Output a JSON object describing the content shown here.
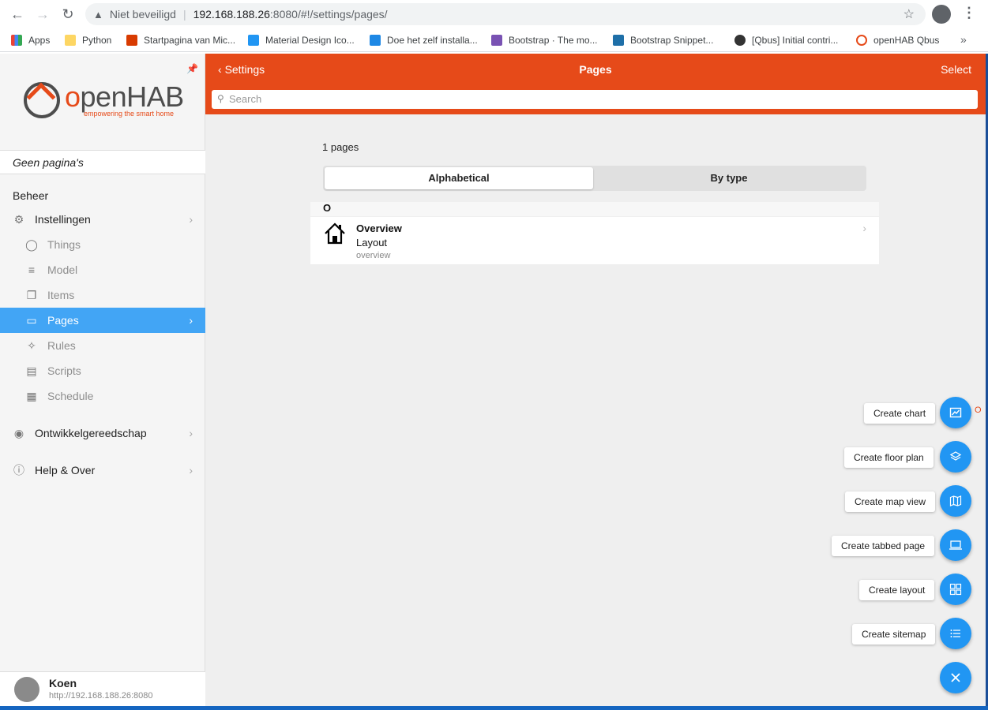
{
  "browser": {
    "security_text": "Niet beveiligd",
    "url_host": "192.168.188.26",
    "url_rest": ":8080/#!/settings/pages/",
    "bookmarks": [
      {
        "label": "Apps",
        "color": "#ea4335"
      },
      {
        "label": "Python",
        "color": "#fdd663"
      },
      {
        "label": "Startpagina van Mic...",
        "color": "#d83b01"
      },
      {
        "label": "Material Design Ico...",
        "color": "#2196f3"
      },
      {
        "label": "Doe het zelf installa...",
        "color": "#1e88e5"
      },
      {
        "label": "Bootstrap · The mo...",
        "color": "#7952b3"
      },
      {
        "label": "Bootstrap Snippet...",
        "color": "#1e6fa8"
      },
      {
        "label": "[Qbus] Initial contri...",
        "color": "#333333"
      },
      {
        "label": "openHAB Qbus",
        "color": "#e64a19"
      }
    ]
  },
  "sidebar": {
    "logo_word": "openHAB",
    "logo_tag": "empowering the smart home",
    "no_pages": "Geen pagina's",
    "section": "Beheer",
    "items": [
      {
        "label": "Instellingen"
      },
      {
        "label": "Things"
      },
      {
        "label": "Model"
      },
      {
        "label": "Items"
      },
      {
        "label": "Pages"
      },
      {
        "label": "Rules"
      },
      {
        "label": "Scripts"
      },
      {
        "label": "Schedule"
      },
      {
        "label": "Ontwikkelgereedschap"
      },
      {
        "label": "Help & Over"
      }
    ],
    "user": {
      "name": "Koen",
      "host": "http://192.168.188.26:8080"
    }
  },
  "navbar": {
    "back": "Settings",
    "title": "Pages",
    "select": "Select",
    "search_placeholder": "Search"
  },
  "main": {
    "count": "1 pages",
    "segments": [
      "Alphabetical",
      "By type"
    ],
    "group": "O",
    "row": {
      "title": "Overview",
      "subtitle": "Layout",
      "uid": "overview"
    }
  },
  "fab": {
    "items": [
      {
        "label": "Create chart"
      },
      {
        "label": "Create floor plan"
      },
      {
        "label": "Create map view"
      },
      {
        "label": "Create tabbed page"
      },
      {
        "label": "Create layout"
      },
      {
        "label": "Create sitemap"
      }
    ],
    "close_icon": "close-icon",
    "color": "#2196f3"
  }
}
